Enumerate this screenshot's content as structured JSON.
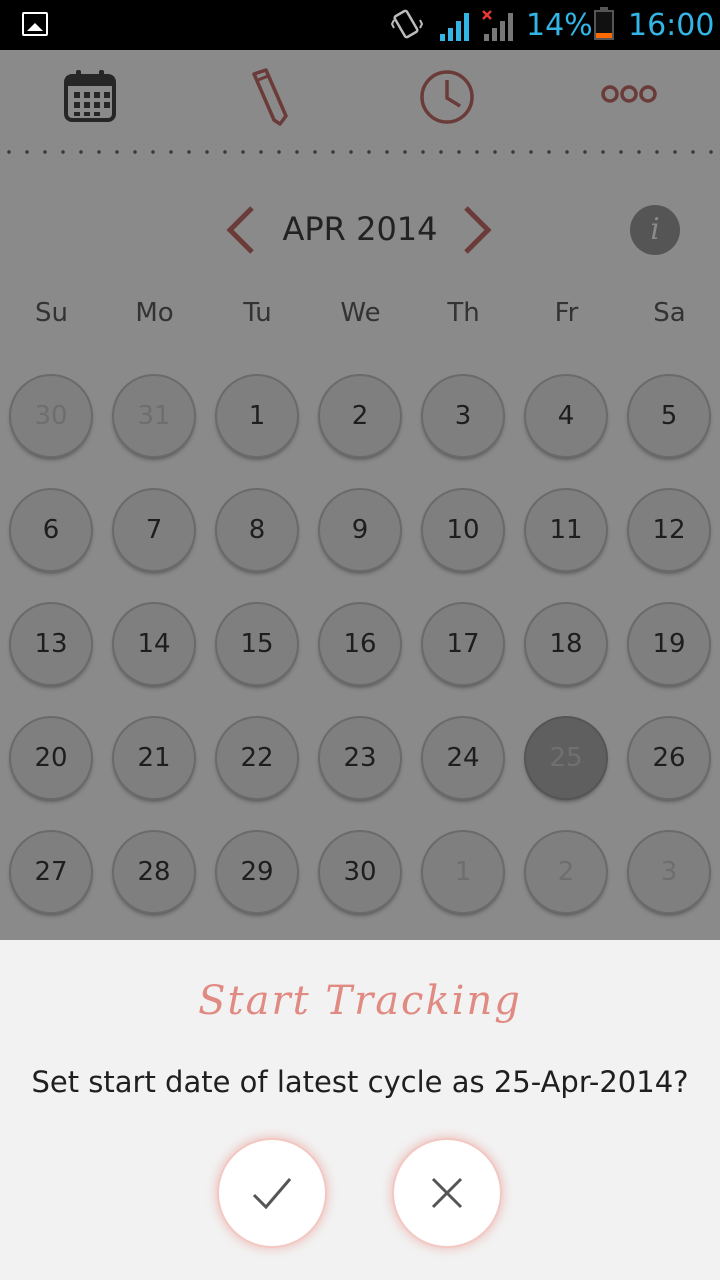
{
  "status_bar": {
    "battery_percent": "14%",
    "time": "16:00",
    "battery_level": 0.14
  },
  "toolbar": {
    "icons": [
      "calendar-icon",
      "pencil-icon",
      "clock-icon",
      "more-icon"
    ]
  },
  "calendar": {
    "month_label": "APR 2014",
    "weekdays": [
      "Su",
      "Mo",
      "Tu",
      "We",
      "Th",
      "Fr",
      "Sa"
    ],
    "weeks": [
      [
        "30",
        "31",
        "1",
        "2",
        "3",
        "4",
        "5"
      ],
      [
        "6",
        "7",
        "8",
        "9",
        "10",
        "11",
        "12"
      ],
      [
        "13",
        "14",
        "15",
        "16",
        "17",
        "18",
        "19"
      ],
      [
        "20",
        "21",
        "22",
        "23",
        "24",
        "25",
        "26"
      ],
      [
        "27",
        "28",
        "29",
        "30",
        "1",
        "2",
        "3"
      ]
    ],
    "selected_day": "25",
    "info_label": "i"
  },
  "dialog": {
    "title": "Start Tracking",
    "message": "Set start date of latest cycle as 25-Apr-2014?",
    "confirm_icon": "check-icon",
    "cancel_icon": "close-icon"
  },
  "colors": {
    "accent": "#c96f6a",
    "overlay": "#8a8a8a",
    "status_text": "#33b5e5"
  }
}
